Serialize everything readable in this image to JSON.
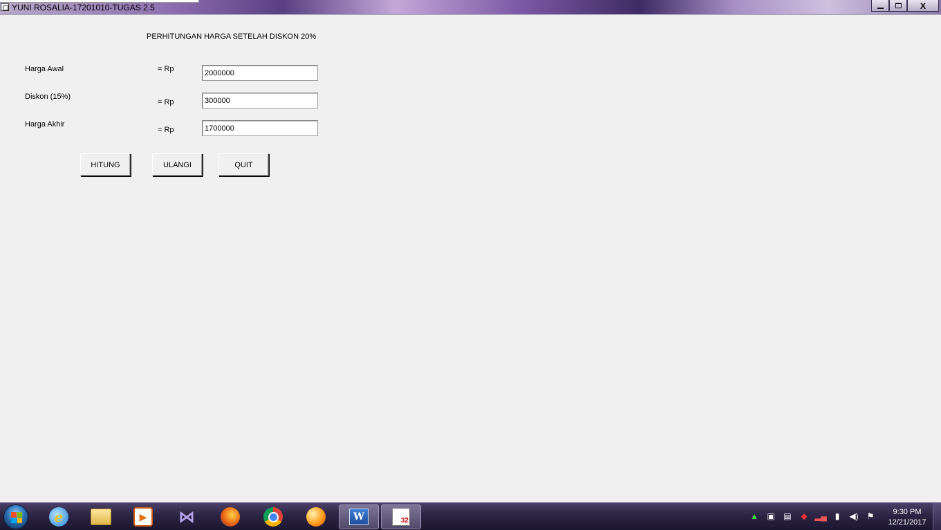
{
  "window": {
    "title": "YUNI ROSALIA-17201010-TUGAS 2.5",
    "controls": {
      "minimize": "minimize",
      "maximize": "maximize",
      "close": "X"
    }
  },
  "form": {
    "heading": "PERHITUNGAN HARGA SETELAH DISKON 20%",
    "rows": [
      {
        "label": "Harga Awal",
        "prefix": "= Rp",
        "value": "2000000"
      },
      {
        "label": "Diskon (15%)",
        "prefix": "= Rp",
        "value": "300000"
      },
      {
        "label": "Harga Akhir",
        "prefix": "= Rp",
        "value": "1700000"
      }
    ],
    "buttons": {
      "hitung": "HITUNG",
      "ulangi": "ULANGI",
      "quit": "QUIT"
    }
  },
  "taskbar": {
    "pinned": [
      {
        "name": "internet-explorer-icon",
        "glyph": "e"
      },
      {
        "name": "file-explorer-icon",
        "glyph": ""
      },
      {
        "name": "media-player-icon",
        "glyph": "▶"
      },
      {
        "name": "visual-studio-icon",
        "glyph": "⋈"
      },
      {
        "name": "firefox-icon",
        "glyph": ""
      },
      {
        "name": "chrome-icon",
        "glyph": ""
      },
      {
        "name": "bubble-app-icon",
        "glyph": ""
      },
      {
        "name": "word-icon",
        "glyph": "W"
      },
      {
        "name": "vb6-icon",
        "glyph": "32"
      }
    ],
    "clock": {
      "time": "9:30 PM",
      "date": "12/21/2017"
    }
  }
}
